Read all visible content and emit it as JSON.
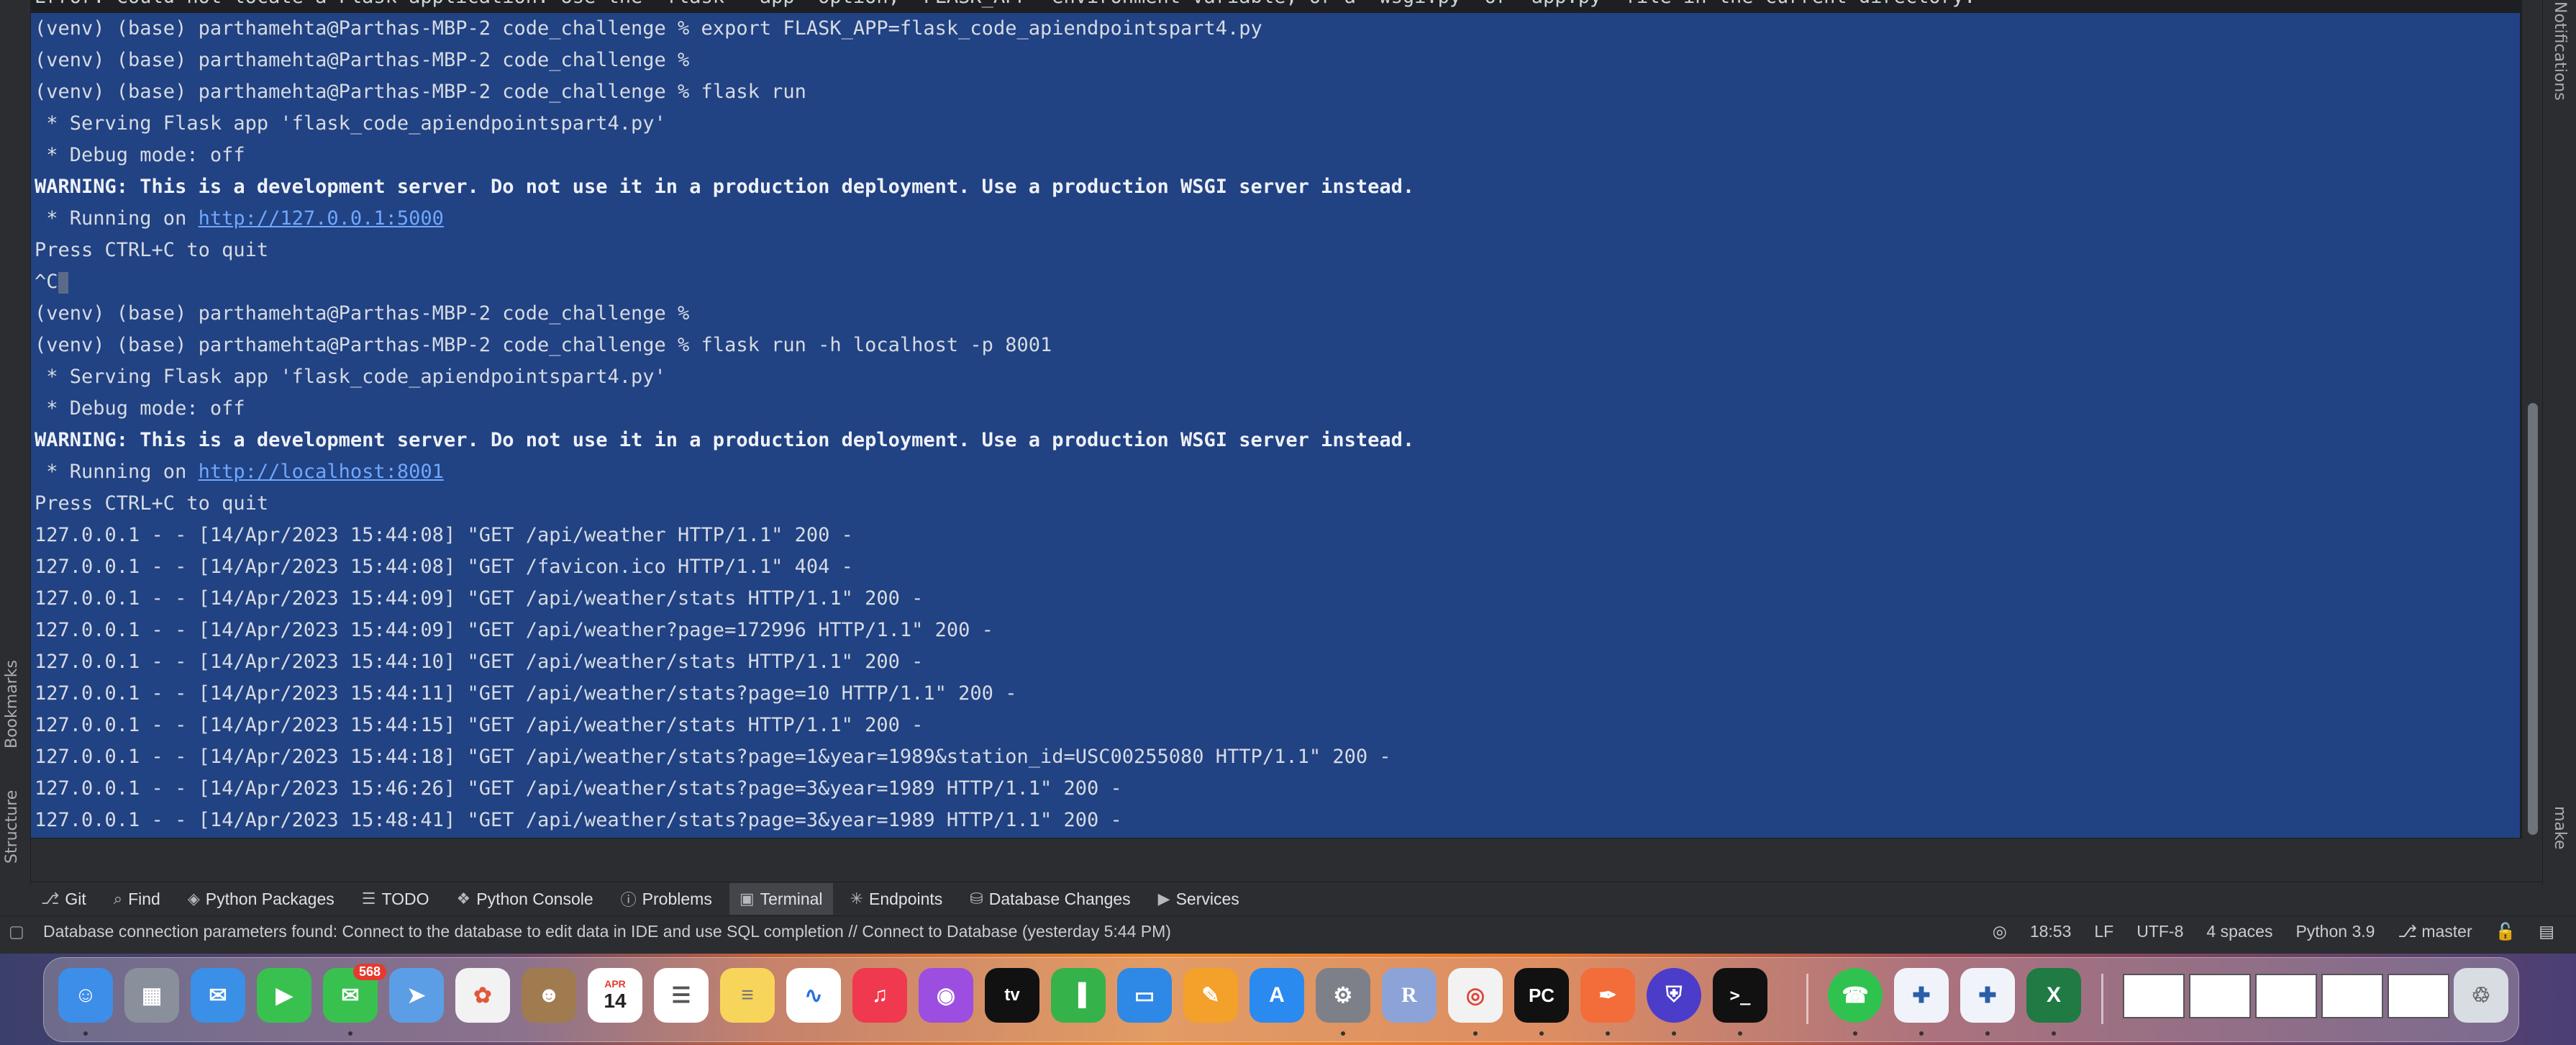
{
  "terminal": {
    "top_partial": "Error: Could not locate a Flask application. Use the 'flask --app' option, 'FLASK_APP' environment variable, or a 'wsgi.py' or 'app.py' file in the current directory.",
    "lines": [
      "(venv) (base) parthamehta@Parthas-MBP-2 code_challenge % export FLASK_APP=flask_code_apiendpointspart4.py",
      "(venv) (base) parthamehta@Parthas-MBP-2 code_challenge %",
      "(venv) (base) parthamehta@Parthas-MBP-2 code_challenge % flask run",
      " * Serving Flask app 'flask_code_apiendpointspart4.py'",
      " * Debug mode: off",
      "WARNING: This is a development server. Do not use it in a production deployment. Use a production WSGI server instead.",
      " * Running on ",
      "Press CTRL+C to quit",
      "^C",
      "(venv) (base) parthamehta@Parthas-MBP-2 code_challenge %",
      "(venv) (base) parthamehta@Parthas-MBP-2 code_challenge % flask run -h localhost -p 8001",
      " * Serving Flask app 'flask_code_apiendpointspart4.py'",
      " * Debug mode: off",
      "WARNING: This is a development server. Do not use it in a production deployment. Use a production WSGI server instead.",
      " * Running on ",
      "Press CTRL+C to quit",
      "127.0.0.1 - - [14/Apr/2023 15:44:08] \"GET /api/weather HTTP/1.1\" 200 -",
      "127.0.0.1 - - [14/Apr/2023 15:44:08] \"GET /favicon.ico HTTP/1.1\" 404 -",
      "127.0.0.1 - - [14/Apr/2023 15:44:09] \"GET /api/weather/stats HTTP/1.1\" 200 -",
      "127.0.0.1 - - [14/Apr/2023 15:44:09] \"GET /api/weather?page=172996 HTTP/1.1\" 200 -",
      "127.0.0.1 - - [14/Apr/2023 15:44:10] \"GET /api/weather/stats HTTP/1.1\" 200 -",
      "127.0.0.1 - - [14/Apr/2023 15:44:11] \"GET /api/weather/stats?page=10 HTTP/1.1\" 200 -",
      "127.0.0.1 - - [14/Apr/2023 15:44:15] \"GET /api/weather/stats HTTP/1.1\" 200 -",
      "127.0.0.1 - - [14/Apr/2023 15:44:18] \"GET /api/weather/stats?page=1&year=1989&station_id=USC00255080 HTTP/1.1\" 200 -",
      "127.0.0.1 - - [14/Apr/2023 15:46:26] \"GET /api/weather/stats?page=3&year=1989 HTTP/1.1\" 200 -",
      "127.0.0.1 - - [14/Apr/2023 15:48:41] \"GET /api/weather/stats?page=3&year=1989 HTTP/1.1\" 200 -"
    ],
    "link1": "http://127.0.0.1:5000",
    "link2": "http://localhost:8001"
  },
  "side_left": {
    "bookmarks": "Bookmarks",
    "structure": "Structure"
  },
  "side_right": {
    "notifications": "Notifications",
    "make": "make"
  },
  "toolbar": [
    {
      "label": "Git",
      "icon": "git-branch-icon"
    },
    {
      "label": "Find",
      "icon": "search-icon"
    },
    {
      "label": "Python Packages",
      "icon": "layers-icon"
    },
    {
      "label": "TODO",
      "icon": "list-icon"
    },
    {
      "label": "Python Console",
      "icon": "python-icon"
    },
    {
      "label": "Problems",
      "icon": "info-icon"
    },
    {
      "label": "Terminal",
      "icon": "terminal-icon"
    },
    {
      "label": "Endpoints",
      "icon": "endpoints-icon"
    },
    {
      "label": "Database Changes",
      "icon": "database-icon"
    },
    {
      "label": "Services",
      "icon": "play-icon"
    }
  ],
  "status": {
    "message": "Database connection parameters found: Connect to the database to edit data in IDE and use SQL completion // Connect to Database (yesterday 5:44 PM)",
    "position": "18:53",
    "line_sep": "LF",
    "encoding": "UTF-8",
    "indent": "4 spaces",
    "interpreter": "Python 3.9",
    "branch": "master"
  },
  "dock": {
    "calendar_month": "APR",
    "calendar_day": "14",
    "messages_badge": "568",
    "r_label": "R",
    "pycharm_label": "PC",
    "terminal_label": ">_"
  }
}
